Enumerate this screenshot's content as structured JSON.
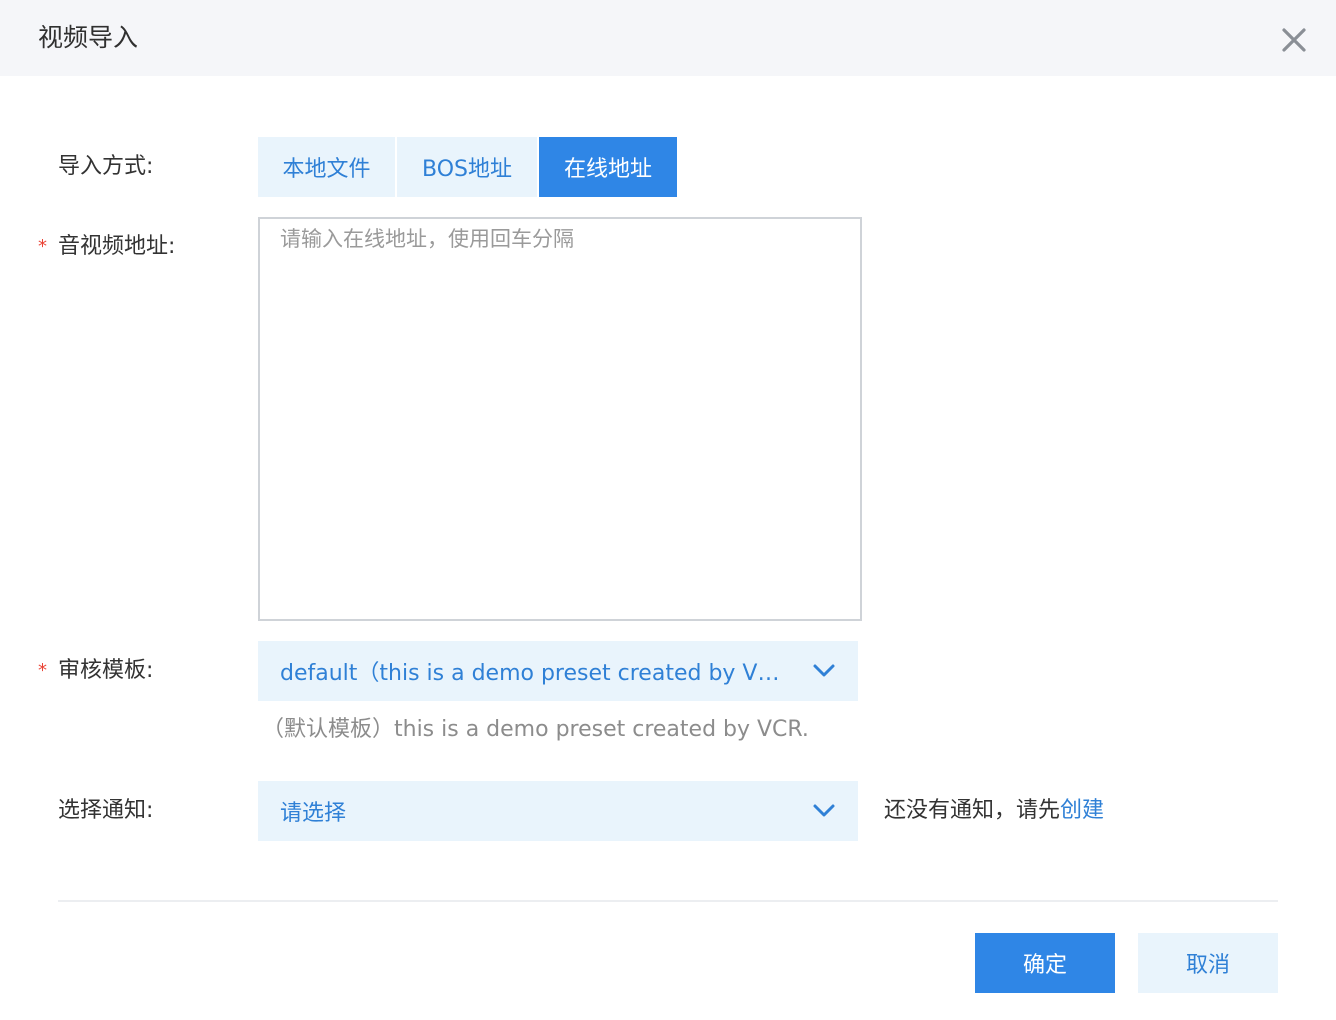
{
  "dialog": {
    "title": "视频导入",
    "close_icon": "close-icon"
  },
  "import_mode": {
    "label": "导入方式:",
    "options": [
      "本地文件",
      "BOS地址",
      "在线地址"
    ],
    "selected": "在线地址"
  },
  "media_url": {
    "required_mark": "*",
    "label": "音视频地址:",
    "placeholder": "请输入在线地址，使用回车分隔",
    "value": ""
  },
  "review_template": {
    "required_mark": "*",
    "label": "审核模板:",
    "selected": "default（this is a demo preset created by V…",
    "hint": "（默认模板）this is a demo preset created by VCR."
  },
  "notification": {
    "label": "选择通知:",
    "selected": "请选择",
    "notice_text": "还没有通知，请先",
    "create_link": "创建"
  },
  "footer": {
    "confirm_label": "确定",
    "cancel_label": "取消"
  },
  "colors": {
    "accent": "#2f86e6",
    "accent_light": "#e9f4fc",
    "header_bg": "#f5f6f9",
    "required": "#ea4335"
  }
}
